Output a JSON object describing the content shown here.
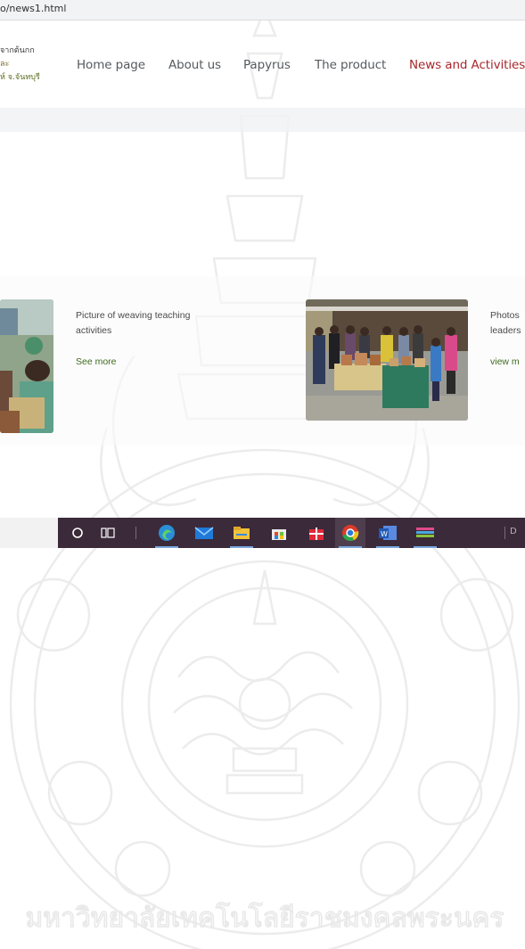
{
  "browser": {
    "address_text": "o/news1.html"
  },
  "header": {
    "logo_lines": [
      "์จากต้นกก",
      "ละ",
      "ห์ จ.จันทบุรี"
    ],
    "nav": [
      {
        "label": "Home page",
        "active": false
      },
      {
        "label": "About us",
        "active": false
      },
      {
        "label": "Papyrus",
        "active": false
      },
      {
        "label": "The product",
        "active": false
      },
      {
        "label": "News and Activities",
        "active": true
      }
    ],
    "accent_color": "#a8282d"
  },
  "news": [
    {
      "caption": "Picture of weaving teaching activities",
      "link": "See more"
    },
    {
      "caption": "Photos leaders",
      "caption_lines": [
        "Photos",
        "leaders"
      ],
      "link": "view m"
    }
  ],
  "taskbar": {
    "icons": [
      "search-circle-icon",
      "task-view-icon",
      "edge-icon",
      "mail-icon",
      "file-explorer-icon",
      "store-icon",
      "gift-icon",
      "chrome-icon",
      "word-icon",
      "media-app-icon"
    ],
    "right_text": "D"
  },
  "watermark": {
    "inscription": "มหาวิทยาลัยเทคโนโลยีราชมงคลพระนคร"
  }
}
